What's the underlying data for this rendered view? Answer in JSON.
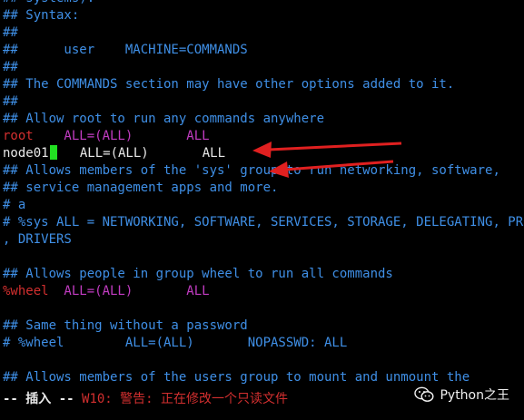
{
  "editor": {
    "lines": {
      "l0": {
        "text": "## systems).",
        "class": "c-comment"
      },
      "l1": {
        "text": "## Syntax:",
        "class": "c-comment"
      },
      "l2": {
        "text": "##",
        "class": "c-comment"
      },
      "l3": {
        "text": "##      user    MACHINE=COMMANDS",
        "class": "c-comment"
      },
      "l4": {
        "text": "##",
        "class": "c-comment"
      },
      "l5": {
        "text": "## The COMMANDS section may have other options added to it.",
        "class": "c-comment"
      },
      "l6": {
        "text": "##",
        "class": "c-comment"
      },
      "l7": {
        "text": "## Allow root to run any commands anywhere",
        "class": "c-comment"
      },
      "l8_user": "root",
      "l8_rest": "    ALL=(ALL)       ALL",
      "l9_user": "node01",
      "l9_rest": "   ALL=(ALL)       ALL",
      "l10": {
        "text": "## Allows members of the 'sys' group to run networking, software,",
        "class": "c-comment"
      },
      "l11": {
        "text": "## service management apps and more.",
        "class": "c-comment"
      },
      "l12": {
        "text": "# a",
        "class": "c-comment"
      },
      "l13": {
        "text": "# %sys ALL = NETWORKING, SOFTWARE, SERVICES, STORAGE, DELEGATING, PROCESSES, LOCATE",
        "class": "c-comment"
      },
      "l14": {
        "text": ", DRIVERS",
        "class": "c-comment"
      },
      "l15": {
        "text": "",
        "class": "c-comment"
      },
      "l16": {
        "text": "## Allows people in group wheel to run all commands",
        "class": "c-comment"
      },
      "l17_user": "%wheel",
      "l17_rest": "  ALL=(ALL)       ALL",
      "l18": {
        "text": "",
        "class": "c-comment"
      },
      "l19": {
        "text": "## Same thing without a password",
        "class": "c-comment"
      },
      "l20": {
        "text": "# %wheel        ALL=(ALL)       NOPASSWD: ALL",
        "class": "c-comment"
      },
      "l21": {
        "text": "",
        "class": "c-comment"
      },
      "l22": {
        "text": "## Allows members of the users group to mount and unmount the",
        "class": "c-comment"
      }
    }
  },
  "status": {
    "mode": "-- 插入 --",
    "warning": "W10: 警告: 正在修改一个只读文件"
  },
  "watermark": {
    "text": "Python之王"
  },
  "colors": {
    "comment": "#3f8fe6",
    "keyword": "#c23cc2",
    "user_highlight": "#d32f2f",
    "cursor": "#22e022",
    "arrow": "#e02020",
    "background": "#000000"
  }
}
